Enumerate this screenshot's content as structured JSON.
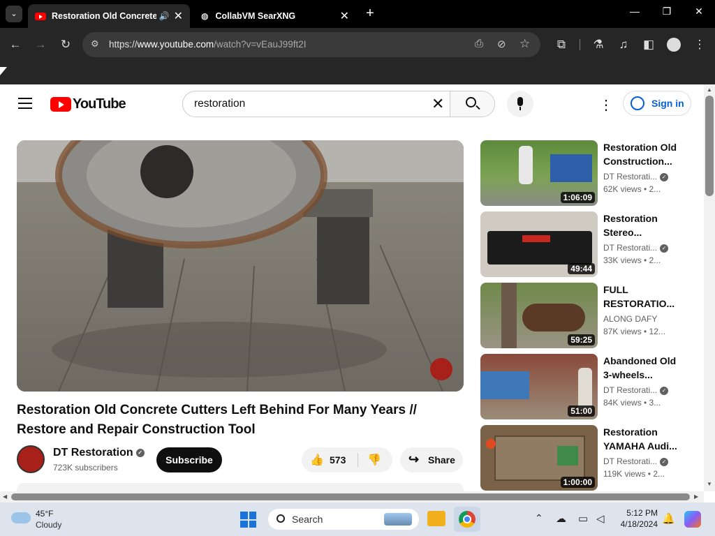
{
  "browser": {
    "tabs": [
      {
        "title": "Restoration Old Concrete C",
        "active": true,
        "audio": true
      },
      {
        "title": "CollabVM SearXNG",
        "active": false
      }
    ],
    "url": {
      "scheme": "https://",
      "host": "www.youtube.com",
      "path": "/watch?v=vEauJ99ft2I"
    }
  },
  "youtube": {
    "logo_text": "YouTube",
    "search": {
      "value": "restoration"
    },
    "sign_in_label": "Sign in",
    "video": {
      "title": "Restoration Old Concrete Cutters Left Behind For Many Years // Restore and Repair Construction Tool",
      "channel": "DT Restoration",
      "subscribers": "723K subscribers",
      "subscribe_label": "Subscribe",
      "likes": "573",
      "share_label": "Share"
    },
    "recommendations": [
      {
        "title": "Restoration Old Construction...",
        "channel": "DT Restorati...",
        "verified": true,
        "meta": "62K views • 2...",
        "duration": "1:06:09"
      },
      {
        "title": "Restoration Stereo...",
        "channel": "DT Restorati...",
        "verified": true,
        "meta": "33K views • 2...",
        "duration": "49:44"
      },
      {
        "title": "FULL RESTORATIO...",
        "channel": "ALONG DAFY",
        "verified": false,
        "meta": "87K views • 12...",
        "duration": "59:25"
      },
      {
        "title": "Abandoned Old 3-wheels...",
        "channel": "DT Restorati...",
        "verified": true,
        "meta": "84K views • 3...",
        "duration": "51:00"
      },
      {
        "title": "Restoration YAMAHA Audi...",
        "channel": "DT Restorati...",
        "verified": true,
        "meta": "119K views • 2...",
        "duration": "1:00:00"
      }
    ]
  },
  "taskbar": {
    "weather": {
      "temp": "45°F",
      "condition": "Cloudy"
    },
    "search_label": "Search",
    "time": "5:12 PM",
    "date": "4/18/2024"
  },
  "colors": {
    "youtube_red": "#ff0000",
    "link_blue": "#065fd4",
    "chrome_dark": "#262626"
  }
}
